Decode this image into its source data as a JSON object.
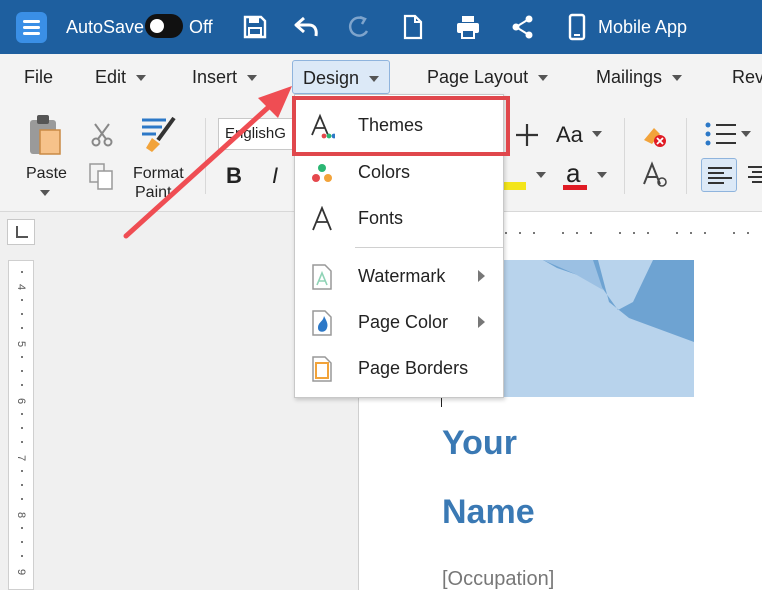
{
  "titlebar": {
    "autosave_label": "AutoSave",
    "toggle_state": "Off",
    "mobile_app_label": "Mobile App"
  },
  "menu": {
    "items": [
      {
        "label": "File",
        "has_chevron": false
      },
      {
        "label": "Edit",
        "has_chevron": true
      },
      {
        "label": "Insert",
        "has_chevron": true
      },
      {
        "label": "Design",
        "has_chevron": true,
        "active": true
      },
      {
        "label": "Page Layout",
        "has_chevron": true
      },
      {
        "label": "Mailings",
        "has_chevron": true
      },
      {
        "label": "Rev",
        "has_chevron": false
      }
    ]
  },
  "ribbon": {
    "paste_label": "Paste",
    "format_painter_line1": "Format",
    "format_painter_line2": "Paint",
    "font_name": "EnglishG",
    "bold_label": "B",
    "italic_label": "I",
    "case_label": "Aa",
    "font_color_label": "a"
  },
  "design_menu": {
    "items": [
      {
        "label": "Themes",
        "icon": "themes-icon",
        "submenu": false
      },
      {
        "label": "Colors",
        "icon": "colors-icon",
        "submenu": false
      },
      {
        "label": "Fonts",
        "icon": "fonts-icon",
        "submenu": false
      },
      {
        "label": "Watermark",
        "icon": "watermark-icon",
        "submenu": true
      },
      {
        "label": "Page Color",
        "icon": "page-color-icon",
        "submenu": true
      },
      {
        "label": "Page Borders",
        "icon": "page-borders-icon",
        "submenu": false
      }
    ]
  },
  "rulers": {
    "vertical_numbers": [
      "4",
      "5",
      "6",
      "7",
      "8",
      "9"
    ]
  },
  "document": {
    "name_line1": "Your",
    "name_line2": "Name",
    "occupation": "[Occupation]"
  },
  "colors": {
    "titlebar": "#1e5f9f",
    "accent": "#3a79b4",
    "highlight": "#e0474c"
  }
}
